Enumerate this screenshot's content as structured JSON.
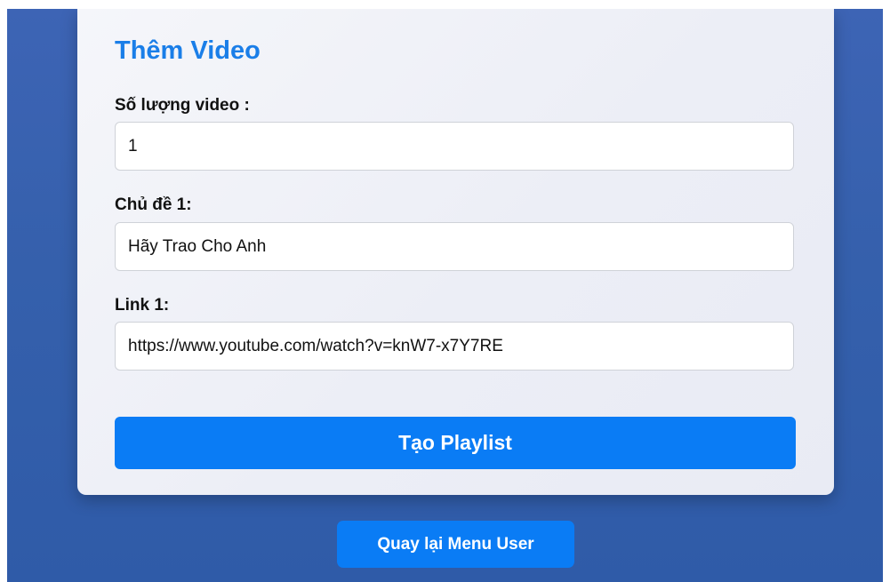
{
  "form": {
    "title": "Thêm Video",
    "fields": [
      {
        "label": "Số lượng video :",
        "value": "1"
      },
      {
        "label": "Chủ đề 1:",
        "value": "Hãy Trao Cho Anh"
      },
      {
        "label": "Link 1:",
        "value": "https://www.youtube.com/watch?v=knW7-x7Y7RE"
      }
    ],
    "submit_label": "Tạo Playlist"
  },
  "footer": {
    "back_label": "Quay lại Menu User"
  },
  "colors": {
    "accent": "#0a7cf5",
    "title": "#1a7ee8",
    "background": "#3560ac"
  }
}
